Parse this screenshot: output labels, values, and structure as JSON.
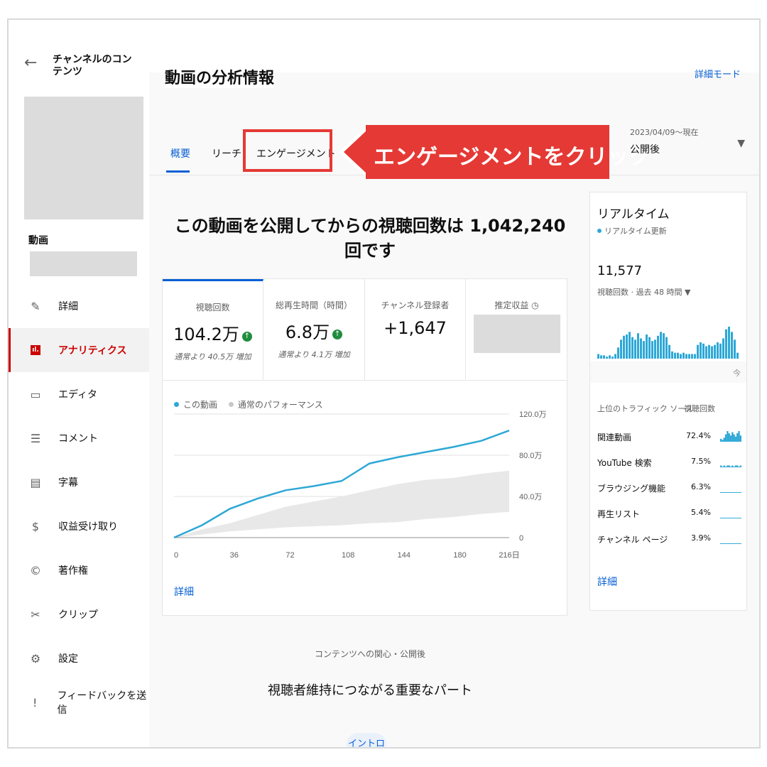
{
  "sidebar": {
    "back_label": "←",
    "title": "チャンネルのコンテンツ",
    "section_label": "動画",
    "nav": [
      {
        "label": "詳細",
        "icon": "pencil-icon",
        "glyph": "✎"
      },
      {
        "label": "アナリティクス",
        "icon": "analytics-icon",
        "glyph": "ıl.",
        "active": true
      },
      {
        "label": "エディタ",
        "icon": "editor-icon",
        "glyph": "▭"
      },
      {
        "label": "コメント",
        "icon": "comment-icon",
        "glyph": "☰"
      },
      {
        "label": "字幕",
        "icon": "subtitles-icon",
        "glyph": "▤"
      },
      {
        "label": "収益受け取り",
        "icon": "dollar-icon",
        "glyph": "$"
      },
      {
        "label": "著作権",
        "icon": "copyright-icon",
        "glyph": "©"
      },
      {
        "label": "クリップ",
        "icon": "scissors-icon",
        "glyph": "✂"
      },
      {
        "label": "設定",
        "icon": "gear-icon",
        "glyph": "⚙"
      },
      {
        "label": "フィードバックを送信",
        "icon": "feedback-icon",
        "glyph": "!"
      }
    ]
  },
  "header": {
    "title": "動画の分析情報",
    "detail_mode": "詳細モード",
    "tabs": [
      "概要",
      "リーチ",
      "エンゲージメント"
    ],
    "active_tab": "概要",
    "callout": "エンゲージメントをクリック",
    "date_range": "2023/04/09～現在",
    "date_label": "公開後",
    "dropdown_glyph": "▼"
  },
  "headline": "この動画を公開してからの視聴回数は 1,042,240 回です",
  "metrics": [
    {
      "label": "視聴回数",
      "value": "104.2万",
      "up": true,
      "note": "通常より 40.5万 増加"
    },
    {
      "label": "総再生時間（時間）",
      "value": "6.8万",
      "up": true,
      "note": "通常より 4.1万 増加"
    },
    {
      "label": "チャンネル登録者",
      "value": "+1,647",
      "up": false,
      "note": ""
    },
    {
      "label": "推定収益",
      "value": "",
      "up": false,
      "note": ""
    }
  ],
  "up_glyph": "↑",
  "clock_glyph": "◷",
  "chart_legend": [
    {
      "name": "この動画",
      "color": "#2ea8d6"
    },
    {
      "name": "通常のパフォーマンス",
      "color": "#c8c8c8"
    }
  ],
  "chart_data": {
    "type": "line",
    "x": [
      0,
      18,
      36,
      54,
      72,
      90,
      108,
      126,
      144,
      162,
      180,
      198,
      216
    ],
    "series": [
      {
        "name": "この動画",
        "values": [
          0,
          12,
          28,
          38,
          46,
          50,
          55,
          72,
          78,
          83,
          88,
          94,
          104
        ]
      }
    ],
    "band": {
      "low": [
        0,
        3,
        6,
        8,
        10,
        11,
        12,
        14,
        15,
        18,
        20,
        23,
        25
      ],
      "high": [
        0,
        8,
        14,
        22,
        30,
        35,
        40,
        46,
        52,
        56,
        58,
        62,
        65
      ]
    },
    "xticks": [
      "0",
      "36",
      "72",
      "108",
      "144",
      "180",
      "216日"
    ],
    "xtick_values": [
      0,
      36,
      72,
      108,
      144,
      180,
      216
    ],
    "yticks": [
      "0",
      "40.0万",
      "80.0万",
      "120.0万"
    ],
    "ytick_values": [
      0,
      40,
      80,
      120
    ],
    "ylim": [
      0,
      120
    ],
    "xlim": [
      0,
      216
    ],
    "line_color": "#2ea8d6",
    "band_color": "#e8e8e8"
  },
  "card_link": "詳細",
  "section": {
    "sub": "コンテンツへの関心・公開後",
    "title": "視聴者維持につながる重要なパート",
    "chip": "イントロ"
  },
  "realtime": {
    "title": "リアルタイム",
    "sub": "リアルタイム更新",
    "count": "11,577",
    "count_label": "視聴回数 · 過去 48 時間 ▼",
    "now_label": "今",
    "bars": [
      3,
      2,
      2,
      1,
      2,
      1,
      3,
      8,
      14,
      17,
      18,
      20,
      16,
      14,
      19,
      15,
      13,
      18,
      16,
      13,
      14,
      17,
      20,
      19,
      16,
      10,
      5,
      4,
      4,
      3,
      4,
      3,
      3,
      3,
      3,
      10,
      12,
      11,
      9,
      10,
      9,
      10,
      12,
      11,
      15,
      22,
      24,
      20,
      14,
      4
    ],
    "bar_color": "#2ea8d6",
    "traffic_header": [
      "上位のトラフィック ソース",
      "視聴回数"
    ],
    "traffic": [
      {
        "name": "関連動画",
        "pct": "72.4%",
        "spark": [
          2,
          1,
          3,
          6,
          9,
          7,
          5,
          8,
          6,
          4,
          7,
          9,
          5
        ]
      },
      {
        "name": "YouTube 検索",
        "pct": "7.5%",
        "spark": [
          1,
          0,
          1,
          0,
          1,
          1,
          0,
          1,
          0,
          1,
          1,
          0,
          1
        ]
      },
      {
        "name": "ブラウジング機能",
        "pct": "6.3%",
        "spark": [
          0,
          0,
          0,
          0,
          0,
          0,
          0,
          0,
          0,
          0,
          0,
          0,
          0
        ]
      },
      {
        "name": "再生リスト",
        "pct": "5.4%",
        "spark": [
          0,
          0,
          0,
          0,
          0,
          0,
          0,
          0,
          0,
          0,
          0,
          0,
          0
        ]
      },
      {
        "name": "チャンネル ページ",
        "pct": "3.9%",
        "spark": [
          0,
          0,
          0,
          0,
          0,
          0,
          0,
          0,
          0,
          0,
          0,
          0,
          0
        ]
      }
    ],
    "link": "詳細"
  }
}
